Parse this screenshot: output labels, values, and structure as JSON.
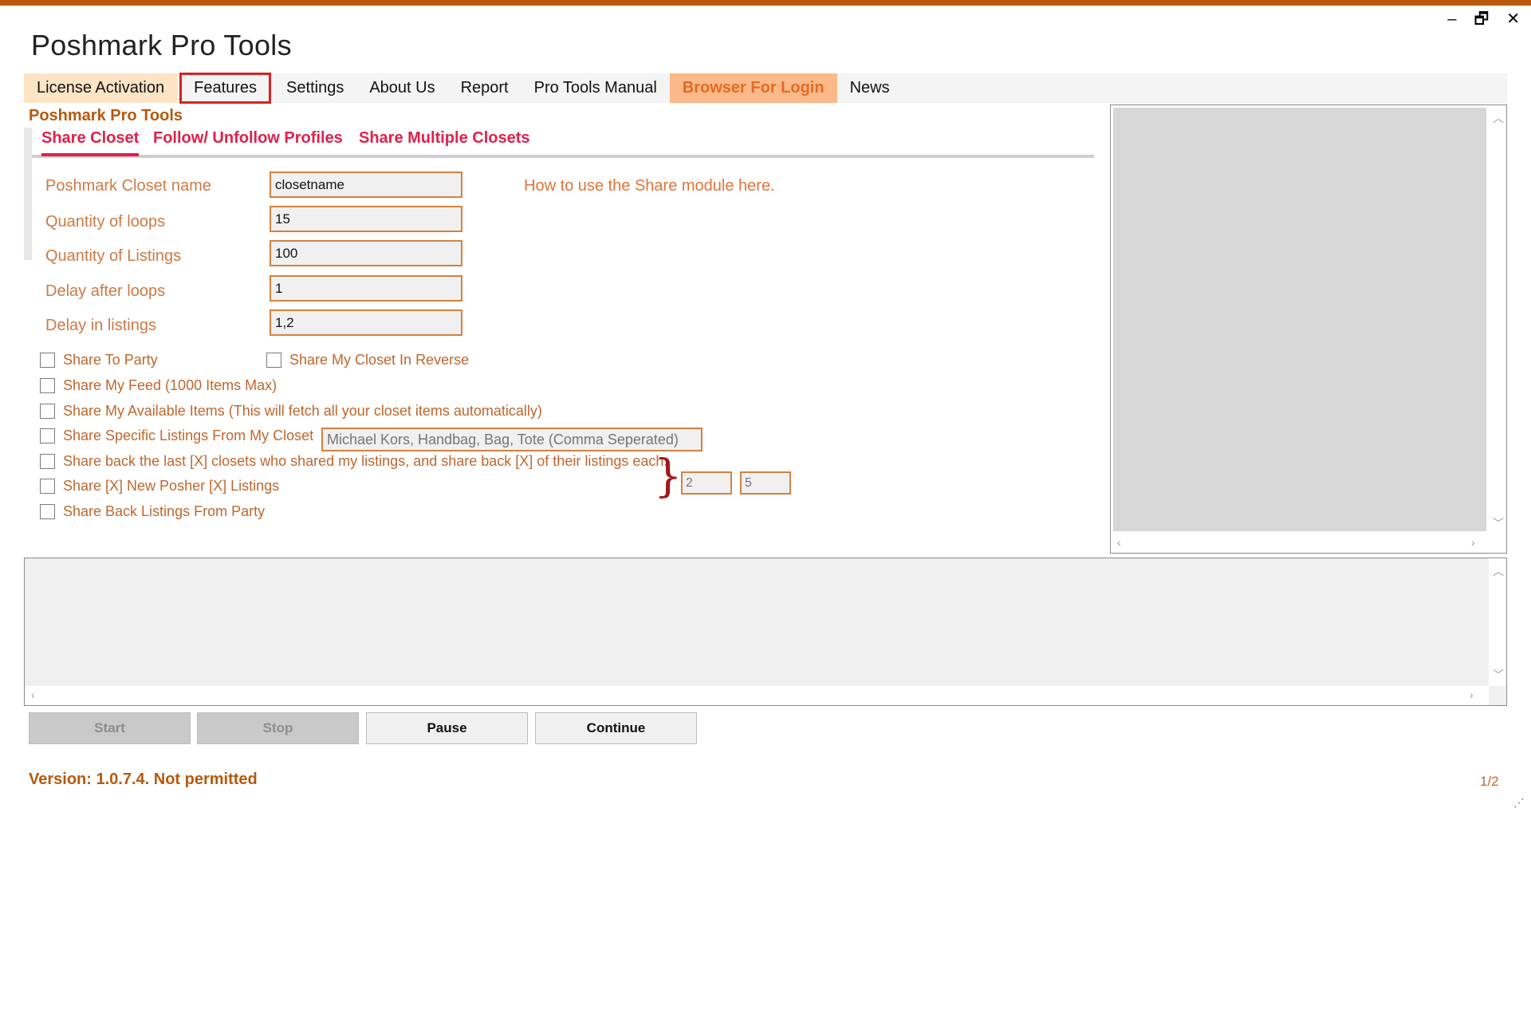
{
  "window": {
    "title": "Poshmark Pro Tools",
    "controls": {
      "minimize": "–",
      "restore": "🗗",
      "close": "✕"
    }
  },
  "menu": {
    "items": [
      {
        "label": "License Activation"
      },
      {
        "label": "Features"
      },
      {
        "label": "Settings"
      },
      {
        "label": "About Us"
      },
      {
        "label": "Report"
      },
      {
        "label": "Pro Tools Manual"
      },
      {
        "label": "Browser For Login"
      },
      {
        "label": "News"
      }
    ]
  },
  "section_title": "Poshmark Pro Tools",
  "subtabs": [
    {
      "label": "Share Closet"
    },
    {
      "label": "Follow/ Unfollow Profiles"
    },
    {
      "label": "Share Multiple Closets"
    }
  ],
  "form": {
    "closet_name": {
      "label": "Poshmark Closet name",
      "value": "closetname"
    },
    "loops": {
      "label": "Quantity of loops",
      "value": "15"
    },
    "listings": {
      "label": "Quantity of Listings",
      "value": "100"
    },
    "delay_loops": {
      "label": "Delay after loops",
      "value": "1"
    },
    "delay_listings": {
      "label": "Delay in listings",
      "value": "1,2"
    },
    "help_link": "How to use the Share module here."
  },
  "options": {
    "share_party": "Share To Party",
    "share_reverse": "Share My Closet In Reverse",
    "share_feed": "Share My Feed (1000 Items Max)",
    "share_available": "Share My Available Items (This will fetch all your closet items automatically)",
    "share_specific": "Share Specific Listings From My Closet",
    "share_specific_placeholder": "Michael Kors, Handbag, Bag, Tote (Comma Seperated)",
    "share_back_last": "Share back the last [X] closets who shared my listings, and share back [X] of their listings each.",
    "share_new_posher": "Share [X] New Posher [X] Listings",
    "share_back_party": "Share Back Listings From Party",
    "x_value_1": "2",
    "x_value_2": "5"
  },
  "buttons": {
    "start": "Start",
    "stop": "Stop",
    "pause": "Pause",
    "continue": "Continue"
  },
  "footer": {
    "version": "Version: 1.0.7.4. Not permitted",
    "page": "1/2"
  }
}
